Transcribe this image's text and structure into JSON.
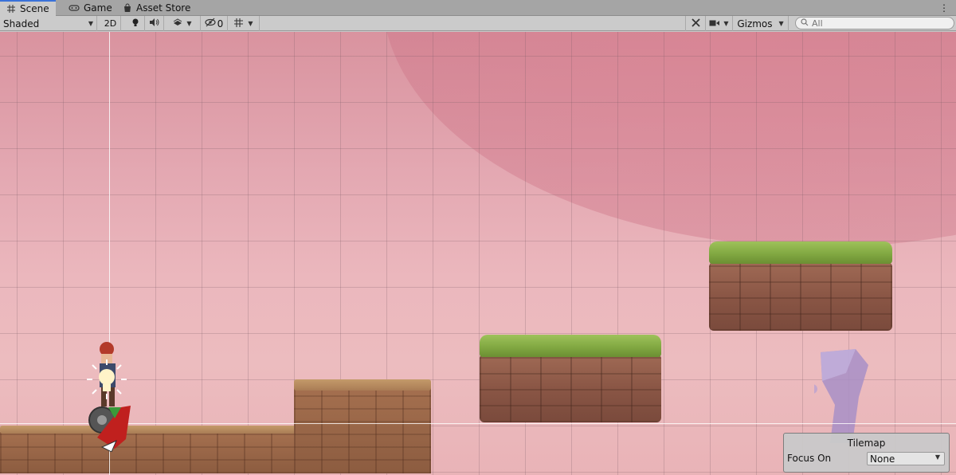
{
  "tabs": [
    {
      "label": "Scene",
      "icon": "scene-grid-icon",
      "active": true
    },
    {
      "label": "Game",
      "icon": "game-controller-icon",
      "active": false
    },
    {
      "label": "Asset Store",
      "icon": "shopping-bag-icon",
      "active": false
    }
  ],
  "toolbar": {
    "draw_mode": "Shaded",
    "mode_2d": "2D",
    "hidden_count": "0",
    "gizmos": "Gizmos",
    "search_placeholder": "All",
    "icons": [
      "lightbulb-icon",
      "speaker-icon",
      "effects-icon",
      "visibility-icon",
      "grid-snap-icon",
      "tools-icon",
      "camera-icon",
      "search-icon"
    ]
  },
  "tilemap_overlay": {
    "title": "Tilemap",
    "focus_label": "Focus On",
    "focus_value": "None"
  },
  "colors": {
    "tab_accent": "#3a72d9",
    "scene_sky": "#ebb7bd"
  }
}
